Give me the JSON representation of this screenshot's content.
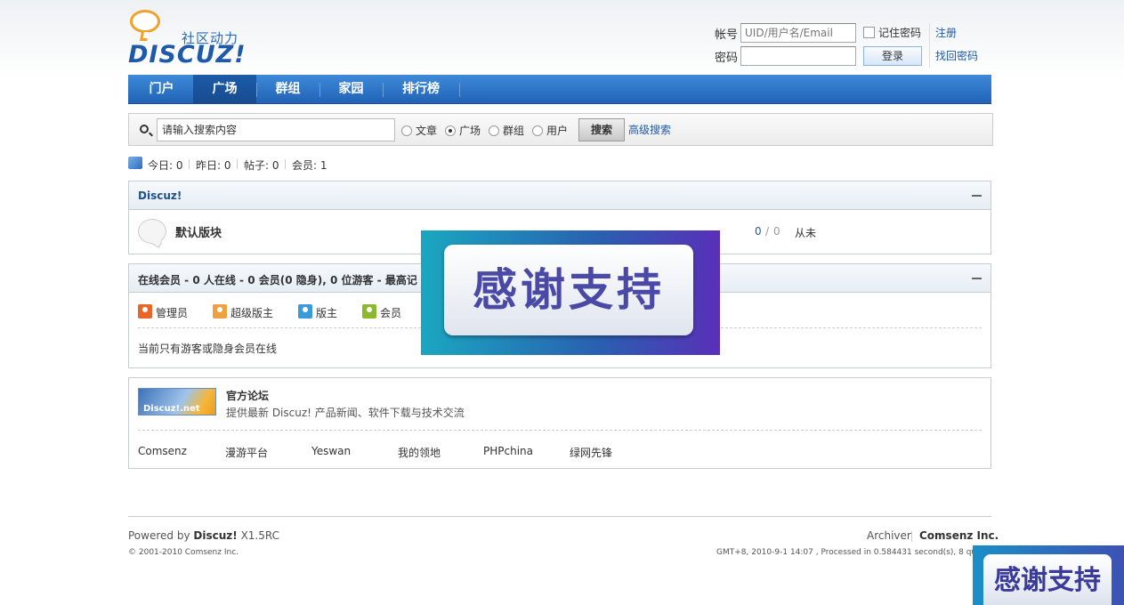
{
  "header": {
    "slogan": "社区动力",
    "brand": "DISCUZ!",
    "login": {
      "username_label": "帐号",
      "username_placeholder": "UID/用户名/Email",
      "password_label": "密码",
      "remember_label": "记住密码",
      "login_button": "登录",
      "register_link": "注册",
      "forgot_link": "找回密码"
    }
  },
  "nav": {
    "items": [
      {
        "label": "门户"
      },
      {
        "label": "广场"
      },
      {
        "label": "群组"
      },
      {
        "label": "家园"
      },
      {
        "label": "排行榜"
      }
    ],
    "active": "广场"
  },
  "search": {
    "placeholder": "请输入搜索内容",
    "options": [
      "文章",
      "广场",
      "群组",
      "用户"
    ],
    "selected": "广场",
    "button": "搜索",
    "advanced": "高级搜索"
  },
  "stats": {
    "today": "今日: 0",
    "yesterday": "昨日: 0",
    "posts": "帖子: 0",
    "members": "会员: 1"
  },
  "category": {
    "title": "Discuz!",
    "forum_name": "默认版块",
    "counts_a": "0",
    "counts_sep": "/",
    "counts_b": "0",
    "last_post": "从未"
  },
  "online": {
    "title": "在线会员 - 0 人在线 - 0 会员(0 隐身), 0 位游客 - 最高记",
    "legend": [
      {
        "label": "管理员",
        "color": "#e8662a"
      },
      {
        "label": "超级版主",
        "color": "#f0a040"
      },
      {
        "label": "版主",
        "color": "#3b9ad8"
      },
      {
        "label": "会员",
        "color": "#8ab92e"
      }
    ],
    "note": "当前只有游客或隐身会员在线"
  },
  "links": {
    "official_logo_text": "Discuz!.net",
    "official_title": "官方论坛",
    "official_desc": "提供最新 Discuz! 产品新闻、软件下载与技术交流",
    "friends": [
      "Comsenz",
      "漫游平台",
      "Yeswan",
      "我的领地",
      "PHPchina",
      "绿网先锋"
    ]
  },
  "popup": {
    "text": "感谢支持"
  },
  "footer": {
    "powered_prefix": "Powered by",
    "powered_brand": "Discuz!",
    "version": "X1.5RC",
    "copyright": "© 2001-2010 Comsenz Inc.",
    "archiver": "Archiver",
    "company": "Comsenz Inc.",
    "timing": "GMT+8, 2010-9-1 14:07 , Processed in 0.584431 second(s), 8 que"
  }
}
